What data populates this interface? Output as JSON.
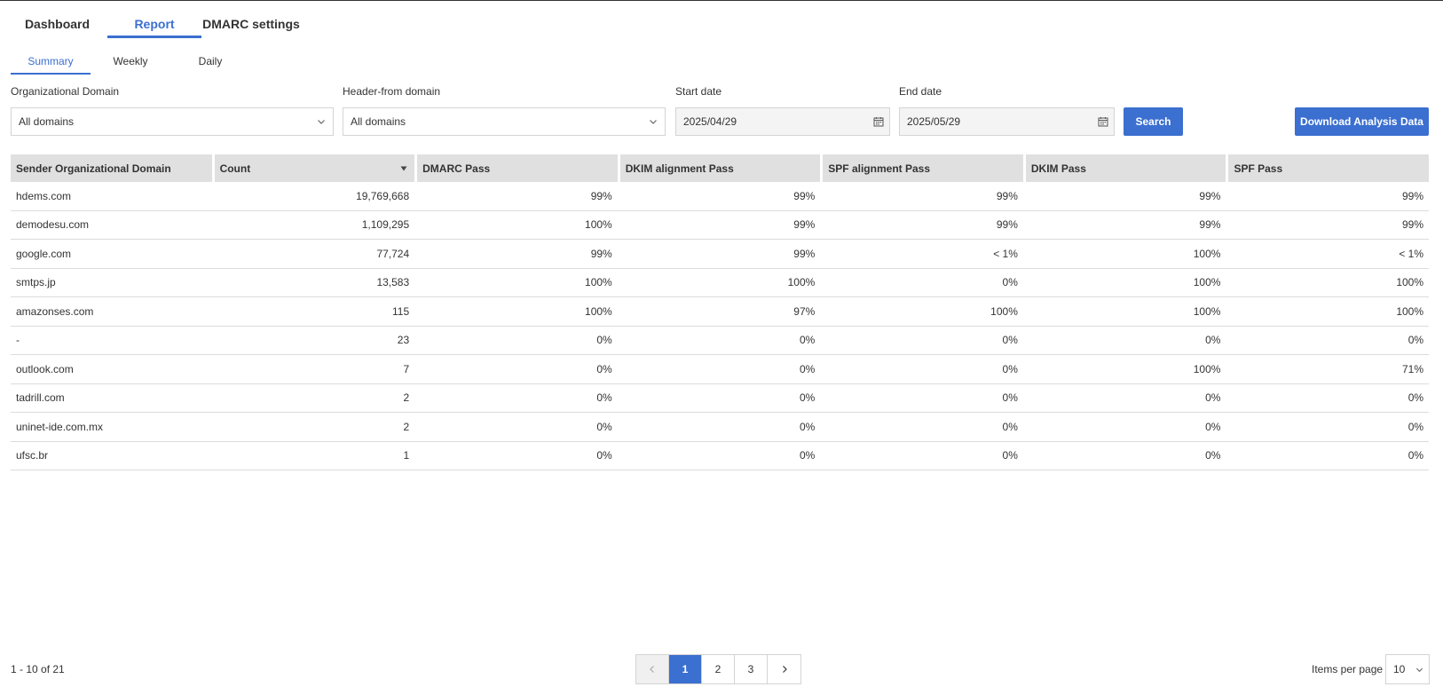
{
  "main_tabs": [
    {
      "label": "Dashboard",
      "active": false
    },
    {
      "label": "Report",
      "active": true
    },
    {
      "label": "DMARC settings",
      "active": false
    }
  ],
  "sub_tabs": [
    {
      "label": "Summary",
      "active": true
    },
    {
      "label": "Weekly",
      "active": false
    },
    {
      "label": "Daily",
      "active": false
    }
  ],
  "filters": {
    "org_domain_label": "Organizational Domain",
    "org_domain_value": "All domains",
    "header_from_label": "Header-from domain",
    "header_from_value": "All domains",
    "start_date_label": "Start date",
    "start_date_value": "2025/04/29",
    "end_date_label": "End date",
    "end_date_value": "2025/05/29",
    "search_label": "Search",
    "download_label": "Download Analysis Data"
  },
  "table": {
    "columns": [
      "Sender Organizational Domain",
      "Count",
      "DMARC Pass",
      "DKIM alignment Pass",
      "SPF alignment Pass",
      "DKIM Pass",
      "SPF Pass"
    ],
    "rows": [
      [
        "hdems.com",
        "19,769,668",
        "99%",
        "99%",
        "99%",
        "99%",
        "99%"
      ],
      [
        "demodesu.com",
        "1,109,295",
        "100%",
        "99%",
        "99%",
        "99%",
        "99%"
      ],
      [
        "google.com",
        "77,724",
        "99%",
        "99%",
        "< 1%",
        "100%",
        "< 1%"
      ],
      [
        "smtps.jp",
        "13,583",
        "100%",
        "100%",
        "0%",
        "100%",
        "100%"
      ],
      [
        "amazonses.com",
        "115",
        "100%",
        "97%",
        "100%",
        "100%",
        "100%"
      ],
      [
        "-",
        "23",
        "0%",
        "0%",
        "0%",
        "0%",
        "0%"
      ],
      [
        "outlook.com",
        "7",
        "0%",
        "0%",
        "0%",
        "100%",
        "71%"
      ],
      [
        "tadrill.com",
        "2",
        "0%",
        "0%",
        "0%",
        "0%",
        "0%"
      ],
      [
        "uninet-ide.com.mx",
        "2",
        "0%",
        "0%",
        "0%",
        "0%",
        "0%"
      ],
      [
        "ufsc.br",
        "1",
        "0%",
        "0%",
        "0%",
        "0%",
        "0%"
      ]
    ]
  },
  "pagination": {
    "range_text": "1 - 10 of 21",
    "pages": [
      "1",
      "2",
      "3"
    ],
    "current_page": "1",
    "items_per_page_label": "Items per page",
    "items_per_page_value": "10"
  },
  "colors": {
    "accent": "#3b6fd0",
    "header_bg": "#e0e0e0"
  }
}
